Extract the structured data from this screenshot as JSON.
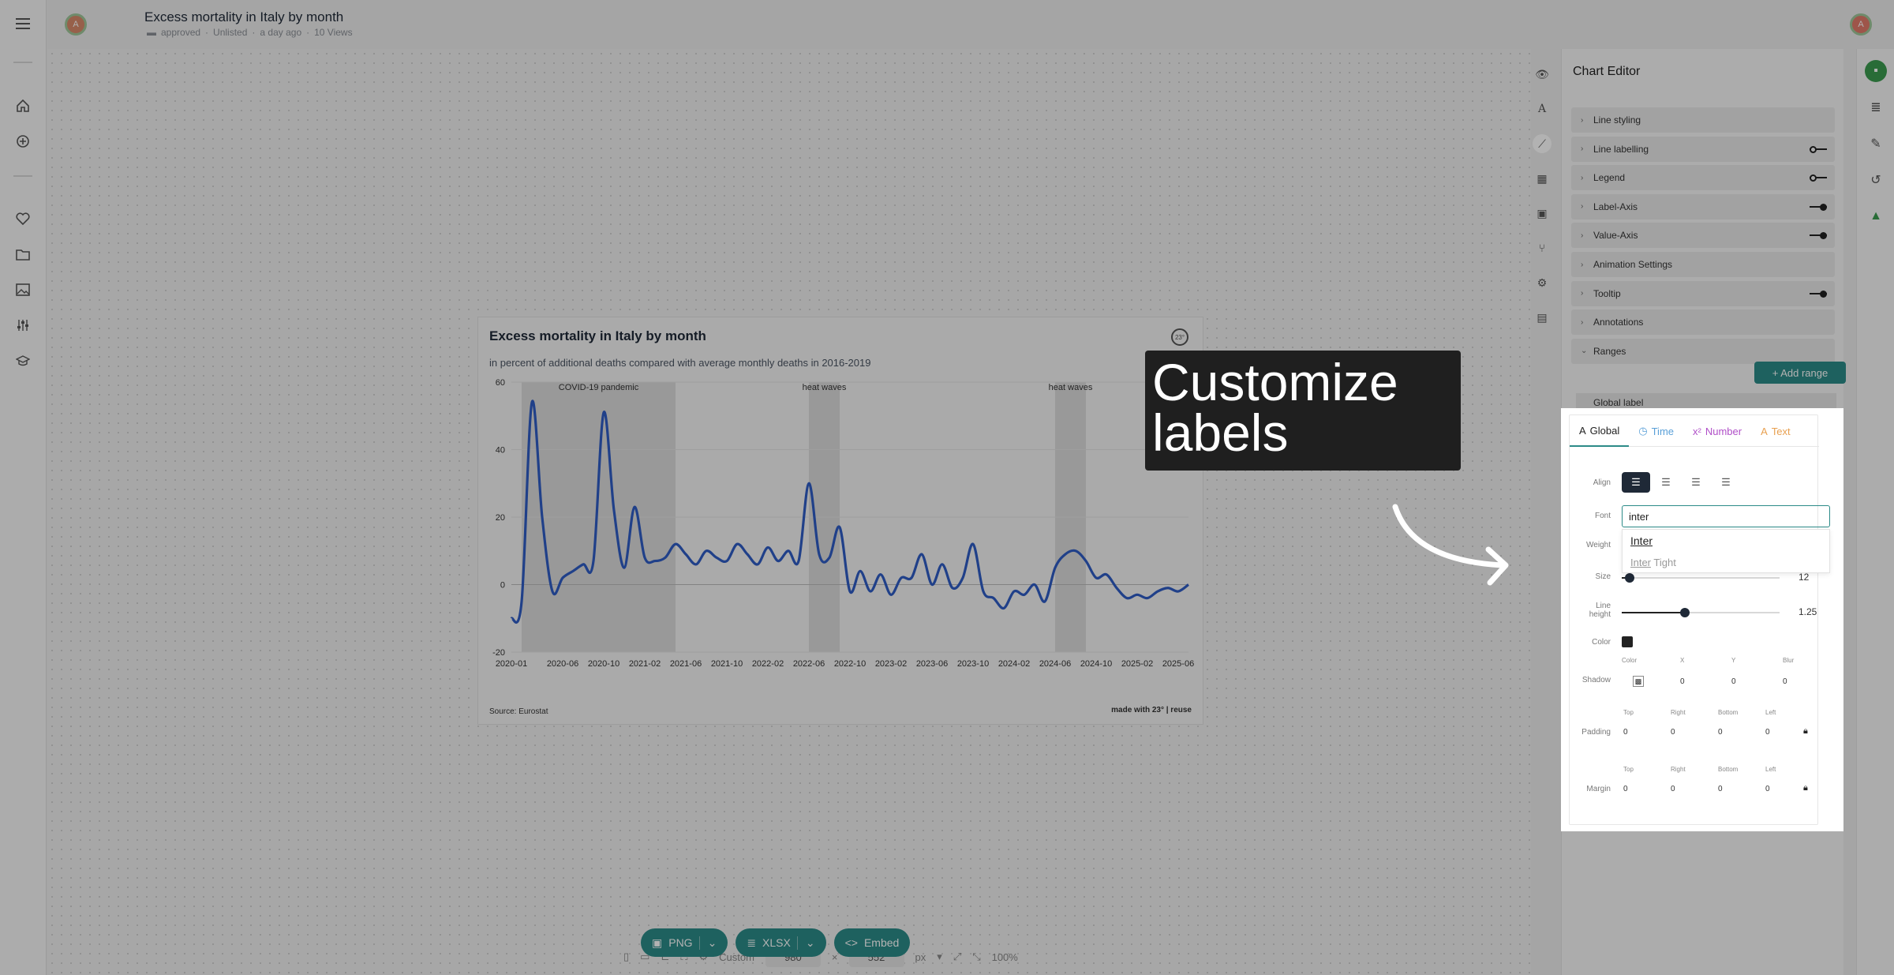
{
  "header": {
    "avatar_initial": "A",
    "title": "Excess mortality in Italy by month",
    "meta": {
      "status": "approved",
      "visibility": "Unlisted",
      "time": "a day ago",
      "views": "10 Views"
    }
  },
  "chart": {
    "title": "Excess mortality in Italy by month",
    "subtitle": "in percent of additional deaths compared with average monthly deaths in 2016-2019",
    "source": "Source: Eurostat",
    "made_with": "made with 23° | reuse",
    "logo": "23°"
  },
  "chart_data": {
    "type": "line",
    "title": "Excess mortality in Italy by month",
    "ylim": [
      -20,
      60
    ],
    "yticks": [
      "60",
      "40",
      "20",
      "0",
      "-20"
    ],
    "xticks": [
      "2020-01",
      "2020-06",
      "2020-10",
      "2021-02",
      "2021-06",
      "2021-10",
      "2022-02",
      "2022-06",
      "2022-10",
      "2023-02",
      "2023-06",
      "2023-10",
      "2024-02",
      "2024-06",
      "2024-10",
      "2025-02",
      "2025-06"
    ],
    "ranges": [
      {
        "label": "COVID-19 pandemic",
        "from": "2020-02",
        "to": "2021-05"
      },
      {
        "label": "heat waves",
        "from": "2022-06",
        "to": "2022-09"
      },
      {
        "label": "heat waves",
        "from": "2024-06",
        "to": "2024-09"
      }
    ],
    "series": [
      {
        "color": "#2f5cc4",
        "x": [
          "2020-01",
          "2020-02",
          "2020-03",
          "2020-04",
          "2020-05",
          "2020-06",
          "2020-07",
          "2020-08",
          "2020-09",
          "2020-10",
          "2020-11",
          "2020-12",
          "2021-01",
          "2021-02",
          "2021-03",
          "2021-04",
          "2021-05",
          "2021-06",
          "2021-07",
          "2021-08",
          "2021-09",
          "2021-10",
          "2021-11",
          "2021-12",
          "2022-01",
          "2022-02",
          "2022-03",
          "2022-04",
          "2022-05",
          "2022-06",
          "2022-07",
          "2022-08",
          "2022-09",
          "2022-10",
          "2022-11",
          "2022-12",
          "2023-01",
          "2023-02",
          "2023-03",
          "2023-04",
          "2023-05",
          "2023-06",
          "2023-07",
          "2023-08",
          "2023-09",
          "2023-10",
          "2023-11",
          "2023-12",
          "2024-01",
          "2024-02",
          "2024-03",
          "2024-04",
          "2024-05",
          "2024-06",
          "2024-07",
          "2024-08",
          "2024-09",
          "2024-10",
          "2024-11",
          "2024-12",
          "2025-01",
          "2025-02",
          "2025-03",
          "2025-04",
          "2025-05",
          "2025-06",
          "2025-07"
        ],
        "values": [
          -10,
          -5,
          54,
          20,
          -2,
          2,
          4,
          6,
          7,
          51,
          22,
          5,
          23,
          8,
          7,
          8,
          12,
          9,
          6,
          10,
          8,
          7,
          12,
          9,
          6,
          11,
          7,
          10,
          7,
          30,
          9,
          8,
          17,
          -2,
          4,
          -2,
          3,
          -3,
          2,
          2,
          9,
          0,
          6,
          -1,
          2,
          12,
          -2,
          -4,
          -7,
          -2,
          -3,
          0,
          -5,
          5,
          9,
          10,
          7,
          2,
          3,
          -1,
          -4,
          -3,
          -4,
          -2,
          -1,
          -2,
          0
        ]
      }
    ]
  },
  "size_bar": {
    "preset": "Custom",
    "width": "980",
    "height": "552",
    "unit": "px",
    "zoom": "100%",
    "times": "×"
  },
  "export": {
    "png": "PNG",
    "xlsx": "XLSX",
    "embed": "Embed"
  },
  "editor": {
    "title": "Chart Editor",
    "sections": [
      {
        "label": "Line styling",
        "toggle": null
      },
      {
        "label": "Line labelling",
        "toggle": "off"
      },
      {
        "label": "Legend",
        "toggle": "off"
      },
      {
        "label": "Label-Axis",
        "toggle": "on"
      },
      {
        "label": "Value-Axis",
        "toggle": "on"
      },
      {
        "label": "Animation Settings",
        "toggle": null
      },
      {
        "label": "Tooltip",
        "toggle": "on"
      },
      {
        "label": "Annotations",
        "toggle": null
      },
      {
        "label": "Ranges",
        "toggle": null
      }
    ],
    "add_range": "+ Add range",
    "global_label": "Global label"
  },
  "callout": {
    "line1": "Customize",
    "line2": "labels"
  },
  "panel": {
    "tabs": [
      {
        "label": "Global",
        "icon": "A",
        "color": "#222222"
      },
      {
        "label": "Time",
        "icon": "◷",
        "color": "#5aa0d8"
      },
      {
        "label": "Number",
        "icon": "x²",
        "color": "#b04fc8"
      },
      {
        "label": "Text",
        "icon": "A",
        "color": "#e8a050"
      }
    ],
    "labels": {
      "align": "Align",
      "font": "Font",
      "weight": "Weight",
      "size": "Size",
      "line_height_1": "Line",
      "line_height_2": "height",
      "color": "Color",
      "shadow": "Shadow",
      "padding": "Padding",
      "margin": "Margin"
    },
    "font_value": "inter",
    "font_options": [
      {
        "match": "Inter",
        "rest": ""
      },
      {
        "match": "Inter",
        "rest": " Tight"
      }
    ],
    "size_value": "12",
    "size_fraction": 0.05,
    "line_height_value": "1.25",
    "line_height_fraction": 0.4,
    "shadow": {
      "headers": [
        "Color",
        "X",
        "Y",
        "Blur"
      ],
      "values": [
        "0",
        "0",
        "0"
      ]
    },
    "padding": {
      "headers": [
        "Top",
        "Right",
        "Bottom",
        "Left"
      ],
      "values": [
        "0",
        "0",
        "0",
        "0"
      ]
    },
    "margin": {
      "headers": [
        "Top",
        "Right",
        "Bottom",
        "Left"
      ],
      "values": [
        "0",
        "0",
        "0",
        "0"
      ]
    }
  },
  "colors": {
    "accent": "#2c8b88",
    "line": "#2f5cc4",
    "overlay": "rgba(0,0,0,0.30)"
  }
}
